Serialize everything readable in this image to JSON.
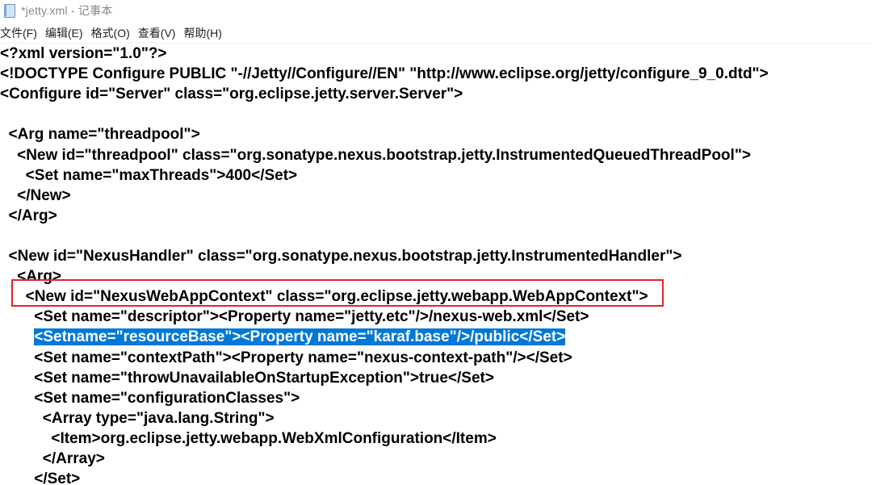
{
  "window": {
    "title": "*jetty.xml - 记事本",
    "icon": "notepad-icon"
  },
  "menu": [
    {
      "label": "文件(F)"
    },
    {
      "label": "编辑(E)"
    },
    {
      "label": "格式(O)"
    },
    {
      "label": "查看(V)"
    },
    {
      "label": "帮助(H)"
    }
  ],
  "editor": {
    "lines": [
      "<?xml version=\"1.0\"?>",
      "<!DOCTYPE Configure PUBLIC \"-//Jetty//Configure//EN\" \"http://www.eclipse.org/jetty/configure_9_0.dtd\">",
      "<Configure id=\"Server\" class=\"org.eclipse.jetty.server.Server\">",
      "",
      "  <Arg name=\"threadpool\">",
      "    <New id=\"threadpool\" class=\"org.sonatype.nexus.bootstrap.jetty.InstrumentedQueuedThreadPool\">",
      "      <Set name=\"maxThreads\">400</Set>",
      "    </New>",
      "  </Arg>",
      "",
      "  <New id=\"NexusHandler\" class=\"org.sonatype.nexus.bootstrap.jetty.InstrumentedHandler\">",
      "    <Arg>",
      "      <New id=\"NexusWebAppContext\" class=\"org.eclipse.jetty.webapp.WebAppContext\">",
      "        <Set name=\"descriptor\"><Property name=\"jetty.etc\"/>/nexus-web.xml</Set>",
      "        <Setname=\"resourceBase\"><Property name=\"karaf.base\"/>/public</Set>",
      "        <Set name=\"contextPath\"><Property name=\"nexus-context-path\"/></Set>",
      "        <Set name=\"throwUnavailableOnStartupException\">true</Set>",
      "        <Set name=\"configurationClasses\">",
      "          <Array type=\"java.lang.String\">",
      "            <Item>org.eclipse.jetty.webapp.WebXmlConfiguration</Item>",
      "          </Array>",
      "        </Set>"
    ],
    "selected_line_index": 14
  },
  "colors": {
    "selection": "#0078d7",
    "annotation_box": "#e1242a"
  }
}
